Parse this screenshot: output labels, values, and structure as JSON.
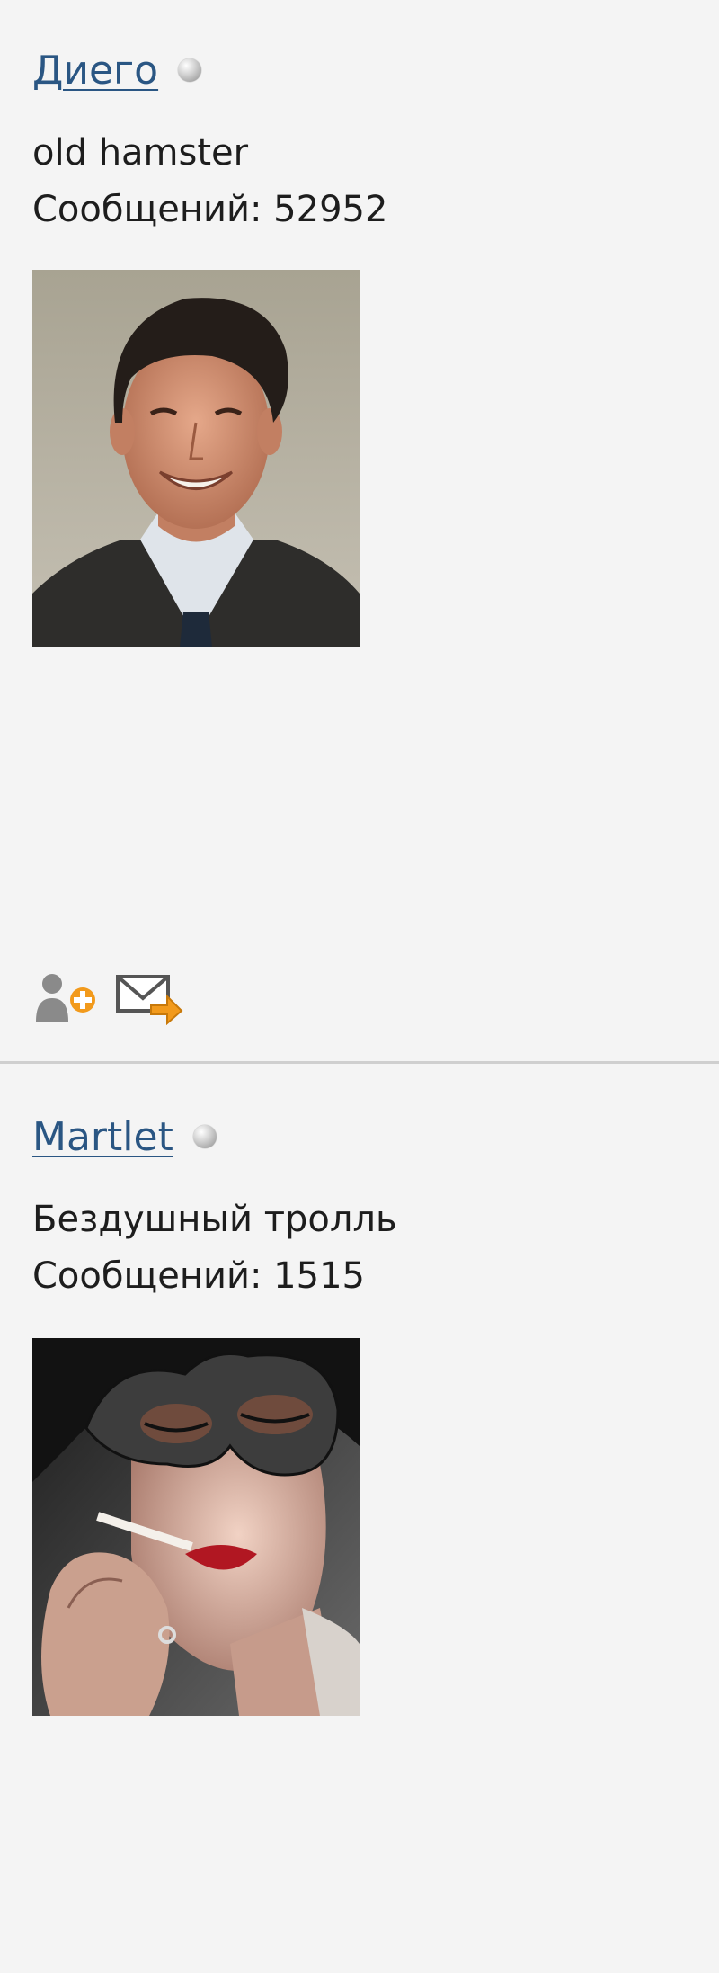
{
  "posts": [
    {
      "username": "Диего",
      "user_title": "old hamster",
      "posts_label": "Сообщений:",
      "post_count": "52952",
      "avatar": "avatar-smiling-man-in-suit",
      "status": "offline",
      "actions": [
        "add-friend-icon",
        "send-message-icon"
      ]
    },
    {
      "username": "Martlet",
      "user_title": "Бездушный тролль",
      "posts_label": "Сообщений:",
      "post_count": "1515",
      "avatar": "avatar-masked-woman-with-cigarette",
      "status": "offline"
    }
  ],
  "colors": {
    "link": "#2a5683",
    "background": "#f4f4f4",
    "divider": "#cfcfcf",
    "icon_accent": "#f29a1c",
    "icon_gray": "#8a8a8a"
  }
}
